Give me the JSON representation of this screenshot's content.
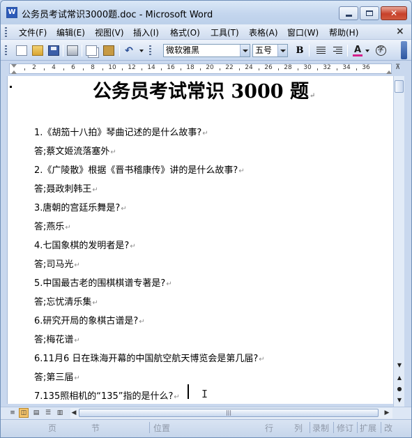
{
  "window": {
    "title": "公务员考试常识3000题.doc - Microsoft Word"
  },
  "menubar": {
    "items": [
      "文件(F)",
      "编辑(E)",
      "视图(V)",
      "插入(I)",
      "格式(O)",
      "工具(T)",
      "表格(A)",
      "窗口(W)",
      "帮助(H)"
    ],
    "close_glyph": "×"
  },
  "toolbar": {
    "font_name": "微软雅黑",
    "font_size": "五号",
    "bold_label": "B",
    "font_color_label": "A",
    "circle_char_label": "字",
    "font_color_underline": "#d5208a"
  },
  "ruler": {
    "labels": [
      "2",
      "4",
      "6",
      "8",
      "10",
      "12",
      "14",
      "16",
      "18",
      "20",
      "22",
      "24",
      "26",
      "28",
      "30",
      "32",
      "34",
      "36"
    ]
  },
  "document": {
    "title": "公务员考试常识 3000 题",
    "paragraphs": [
      "1.《胡笳十八拍》琴曲记述的是什么故事?",
      "答;蔡文姬流落塞外",
      "2.《广陵散》根据《晋书稽康传》讲的是什么故事?",
      "答;聂政刺韩王",
      "3.唐朝的宫廷乐舞是?",
      "答;燕乐",
      "4.七国象棋的发明者是?",
      "答;司马光",
      "5.中国最古老的围棋棋谱专著是?",
      "答;忘忧清乐集",
      "6.研究开局的象棋古谱是?",
      "答;梅花谱",
      "6.11月6 日在珠海开幕的中国航空航天博览会是第几届?",
      "答;第三届",
      "7.135照相机的“135”指的是什么?"
    ],
    "paragraph_mark": "↵"
  },
  "statusbar": {
    "page": "页",
    "section": "节",
    "position": "位置",
    "line": "行",
    "column": "列",
    "record": "录制",
    "revise": "修订",
    "extend": "扩展",
    "overtype": "改"
  }
}
